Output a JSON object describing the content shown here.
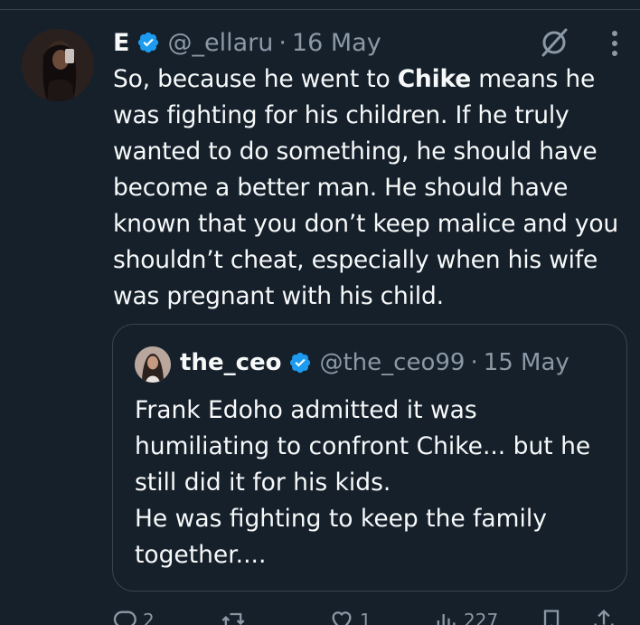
{
  "tweet": {
    "display_name": "E",
    "handle": "@_ellaru",
    "separator": "·",
    "date": "16 May",
    "text_part1": "So, because he went to ",
    "text_bold": "Chike",
    "text_part2": " means he was fighting for his children. If he truly wanted to do something, he should have become a better man. He should have known that you don’t keep malice and you shouldn’t cheat, especially when his wife was pregnant with his child."
  },
  "quote": {
    "display_name": "the_ceo",
    "handle": "@the_ceo99",
    "separator": "·",
    "date": "15 May",
    "text": "Frank Edoho admitted it was humiliating to confront Chike... but he still did it for his kids.\nHe was fighting to keep the family together...."
  },
  "actions": {
    "replies": "2",
    "reposts": "",
    "likes": "1",
    "views": "227"
  },
  "colors": {
    "background": "#15202b",
    "text": "#f7f9f9",
    "secondary": "#8b98a5",
    "border": "#38444d",
    "verified": "#1d9bf0"
  }
}
